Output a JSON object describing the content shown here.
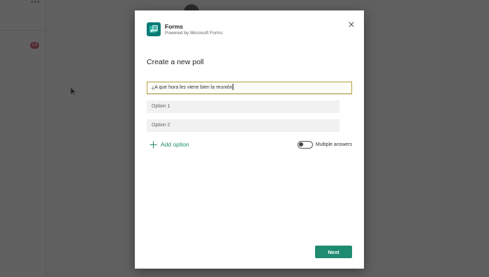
{
  "background": {
    "more_label": "•••",
    "unread_badge": "13"
  },
  "dialog": {
    "app_name": "Forms",
    "app_subtitle": "Powered by Microsoft Forms",
    "title": "Create a new poll",
    "question_value": "¿A que hora les viene bien la reunión",
    "options": [
      {
        "placeholder": "Option 1"
      },
      {
        "placeholder": "Option 2"
      }
    ],
    "add_option_label": "Add option",
    "multiple_answers_label": "Multiple answers",
    "multiple_answers_enabled": false,
    "next_label": "Next"
  },
  "colors": {
    "accent": "#1f8b70",
    "forms_logo": "#0b7a74",
    "overlay": "#5a5a5a"
  },
  "icons": {
    "app_logo": "forms-logo-icon",
    "close": "close-icon",
    "add": "plus-icon",
    "pointer": "mouse-cursor-icon"
  }
}
